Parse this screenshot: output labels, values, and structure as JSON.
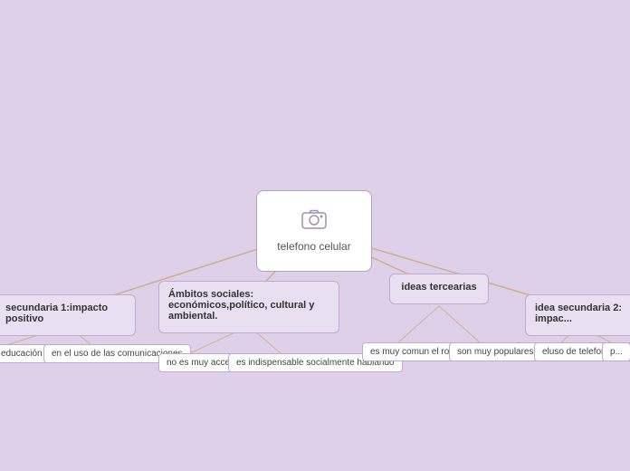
{
  "mindmap": {
    "background_color": "#ddd0e8",
    "center": {
      "label": "telefono celular",
      "icon": "camera"
    },
    "branches": [
      {
        "id": "sec1",
        "title": "secundaria 1:impacto positivo",
        "leaves": [
          "educación",
          "en el uso de las comunicaciones"
        ]
      },
      {
        "id": "ambitos",
        "title": "Ámbitos sociales: económicos,político, cultural y ambiental.",
        "leaves": [
          "no es muy accesible",
          "es indispensable socialmente hablando"
        ]
      },
      {
        "id": "ideas",
        "title": "ideas tercearias",
        "leaves": [
          "es muy comun el robo",
          "son muy populares"
        ]
      },
      {
        "id": "sec2",
        "title": "idea secundaria 2: impac...",
        "leaves": [
          "eluso de telefono en niños",
          "p..."
        ]
      }
    ]
  }
}
